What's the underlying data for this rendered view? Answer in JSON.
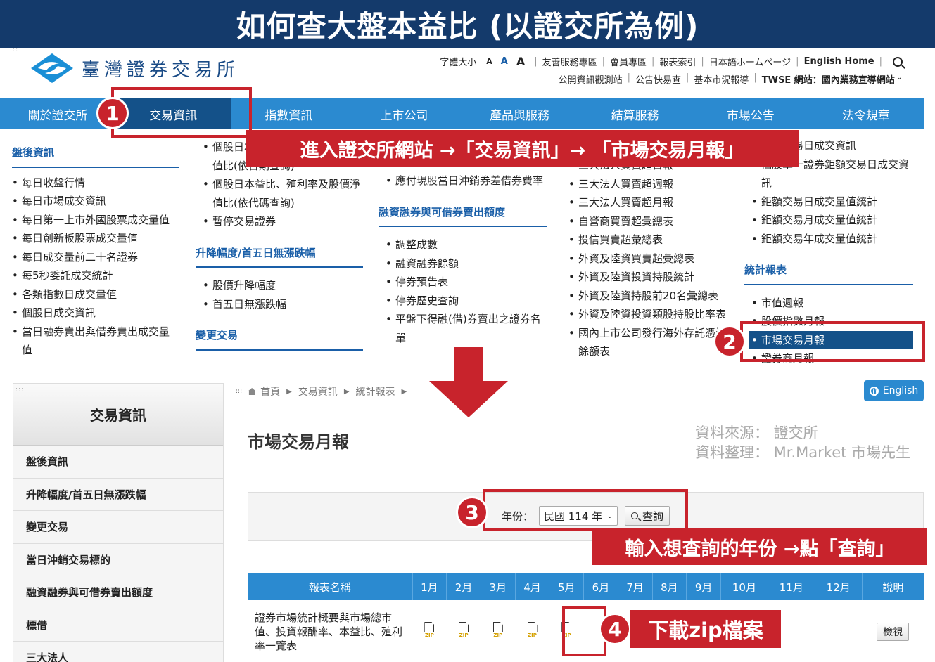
{
  "banner": {
    "title": "如何查大盤本益比 (以證交所為例)"
  },
  "header": {
    "logo_text": "臺灣證券交易所",
    "font_size_label": "字體大小",
    "font_sizes": [
      "A",
      "A",
      "A"
    ],
    "top_links": [
      "友善服務專區",
      "會員專區",
      "報表索引",
      "日本語ホームページ",
      "English Home"
    ],
    "top_links2": [
      "公開資訊觀測站",
      "公告快易查",
      "基本市況報導",
      "TWSE 網站：國內業務宣導網站"
    ]
  },
  "nav": {
    "items": [
      "關於證交所",
      "交易資訊",
      "指數資訊",
      "上市公司",
      "產品與服務",
      "結算服務",
      "市場公告",
      "法令規章"
    ]
  },
  "mega": {
    "col1": {
      "title": "盤後資訊",
      "items": [
        "每日收盤行情",
        "每日市場成交資訊",
        "每日第一上市外國股票成交量值",
        "每日創新板股票成交量值",
        "每日成交量前二十名證券",
        "每5秒委託成交統計",
        "各類指數日成交量值",
        "個股日成交資訊",
        "當日融券賣出與借券賣出成交量值"
      ]
    },
    "col2": {
      "items_top": [
        "個股日本益比、殖利率及股價淨值比(依日期查詢)",
        "個股日本益比、殖利率及股價淨值比(依代碼查詢)",
        "暫停交易證券"
      ],
      "title2": "升降幅度/首五日無漲跌幅",
      "items2": [
        "股價升降幅度",
        "首五日無漲跌幅"
      ],
      "title3": "變更交易"
    },
    "col3": {
      "items_top": [
        "應付現股當日沖銷券差借券費率"
      ],
      "title2": "融資融券與可借券賣出額度",
      "items2": [
        "調整成數",
        "融資融券餘額",
        "停券預告表",
        "停券歷史查詢",
        "平盤下得融(借)券賣出之證券名單"
      ]
    },
    "col4": {
      "items": [
        "三大法人買賣超日報",
        "三大法人買賣超週報",
        "三大法人買賣超月報",
        "自營商買賣超彙總表",
        "投信買賣超彙總表",
        "外資及陸資買賣超彙總表",
        "外資及陸資投資持股統計",
        "外資及陸資持股前20名彙總表",
        "外資及陸資投資類股持股比率表",
        "國內上市公司發行海外存託憑證餘額表"
      ]
    },
    "col5": {
      "items_top": [
        "鉅額交易日成交資訊",
        "個股單一證券鉅額交易日成交資訊",
        "鉅額交易日成交量值統計",
        "鉅額交易月成交量值統計",
        "鉅額交易年成交量值統計"
      ],
      "title2": "統計報表",
      "items2": [
        "市值週報",
        "股價指數月報",
        "市場交易月報",
        "證券商月報"
      ]
    }
  },
  "sidebar": {
    "title": "交易資訊",
    "items": [
      "盤後資訊",
      "升降幅度/首五日無漲跌幅",
      "變更交易",
      "當日沖銷交易標的",
      "融資融券與可借券賣出額度",
      "標借",
      "三大法人"
    ]
  },
  "breadcrumb": [
    "首頁",
    "交易資訊",
    "統計報表"
  ],
  "english_button": "English",
  "page_title": "市場交易月報",
  "source_note": {
    "line1": "資料來源：  證交所",
    "line2": "資料整理：  Mr.Market 市場先生"
  },
  "query": {
    "label": "年份：",
    "year": "民國 114 年",
    "button": "查詢"
  },
  "table": {
    "headers": [
      "報表名稱",
      "1月",
      "2月",
      "3月",
      "4月",
      "5月",
      "6月",
      "7月",
      "8月",
      "9月",
      "10月",
      "11月",
      "12月",
      "說明"
    ],
    "row_name": "證券市場統計概要與市場總市值、投資報酬率、本益比、殖利率一覽表",
    "zip_label": "ZIP",
    "view_label": "檢視"
  },
  "annotations": {
    "step1": "1",
    "step2": "2",
    "step3": "3",
    "step4": "4",
    "callout1": "進入證交所網站 →「交易資訊」→ 「市場交易月報」",
    "callout3": "輸入想查詢的年份 →點「查詢」",
    "callout4": "下載zip檔案",
    "accent": "#c8232c"
  }
}
